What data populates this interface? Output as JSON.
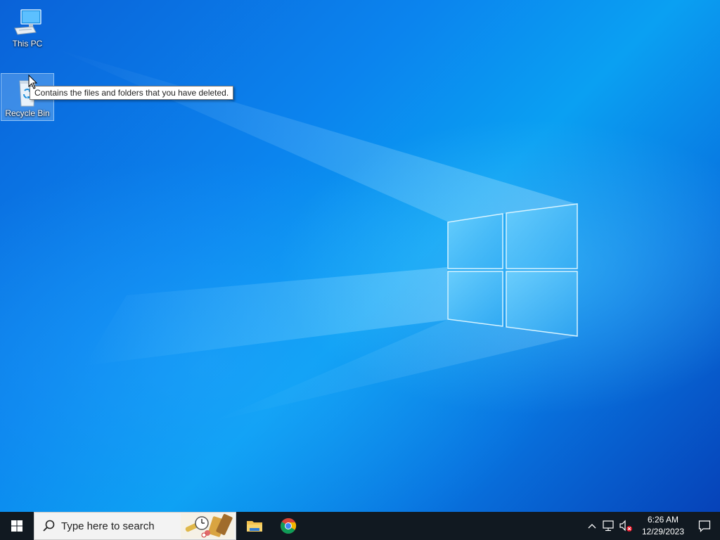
{
  "desktop": {
    "icons": [
      {
        "label": "This PC",
        "icon": "computer-icon"
      },
      {
        "label": "Recycle Bin",
        "icon": "recycle-bin-icon"
      }
    ],
    "tooltip": "Contains the files and folders that you have deleted."
  },
  "taskbar": {
    "start_icon": "windows-logo-icon",
    "search": {
      "placeholder": "Type here to search",
      "icon": "search-icon"
    },
    "pinned_apps": [
      {
        "name": "File Explorer",
        "icon": "folder-icon"
      },
      {
        "name": "Google Chrome",
        "icon": "chrome-icon"
      }
    ],
    "tray": {
      "icons": [
        "chevron-up-icon",
        "network-icon",
        "volume-muted-icon"
      ],
      "time": "6:26 AM",
      "date": "12/29/2023",
      "notification_icon": "notification-icon"
    }
  },
  "colors": {
    "wallpaper_blue": "#0a6fd6",
    "taskbar": "#111921",
    "search_box": "#f3f3f3"
  }
}
